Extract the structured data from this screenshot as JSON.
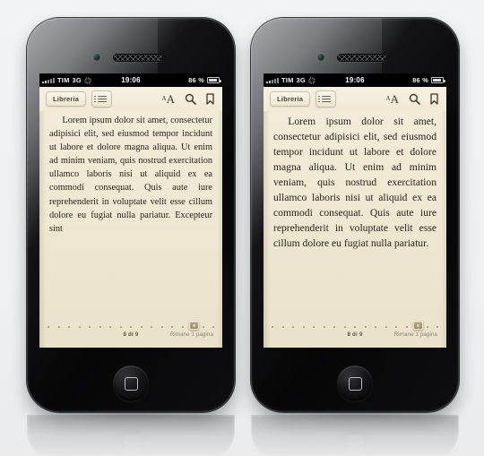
{
  "scene": {
    "background_color": "#eef0f2",
    "device_count": 2,
    "device_name": "smartphone"
  },
  "status_bar": {
    "carrier": "TIM",
    "network": "3G",
    "time": "19:06",
    "battery_percent": "86 %",
    "battery_level": 86,
    "signal_bars": 5,
    "activity_indicator": "spinner-icon",
    "battery_icon": "battery-icon"
  },
  "toolbar": {
    "library_label": "Libreria",
    "contents_icon": "list-icon",
    "font_size_icon": "font-size-icon",
    "font_size_label_small": "A",
    "font_size_label_large": "A",
    "search_icon": "search-icon",
    "bookmark_icon": "bookmark-icon"
  },
  "footer": {
    "page_label": "8 di 9",
    "remaining_label": "Rimane 1 pagina",
    "dot_count": 17,
    "knob_position_index": 14
  },
  "phones": [
    {
      "id": "left",
      "text_size": "small",
      "body_text": "Lorem ipsum dolor sit amet, consectetur adipisici elit, sed eiusmod tempor incidunt ut labore et dolore magna aliqua. Ut enim ad minim veniam, quis nostrud exercitation ullamco laboris nisi ut aliquid ex ea commodi consequat. Quis aute iure reprehenderit in voluptate velit esse cillum dolore eu fugiat nulla pariatur. Excepteur sint"
    },
    {
      "id": "right",
      "text_size": "large",
      "body_text": "Lorem ipsum dolor sit amet, consectetur adipisici elit, sed eiusmod tempor incidunt ut labore et dolore magna aliqua. Ut enim ad minim veniam, quis nostrud exercitation ullamco laboris nisi ut aliquid ex ea commodi consequat. Quis aute iure reprehenderit in voluptate velit esse cillum dolore eu fugiat nulla pariatur."
    }
  ],
  "colors": {
    "page_background": "#efe8d2",
    "text": "#241f18",
    "device_body": "#0b0b0d",
    "status_bar": "#000000"
  }
}
